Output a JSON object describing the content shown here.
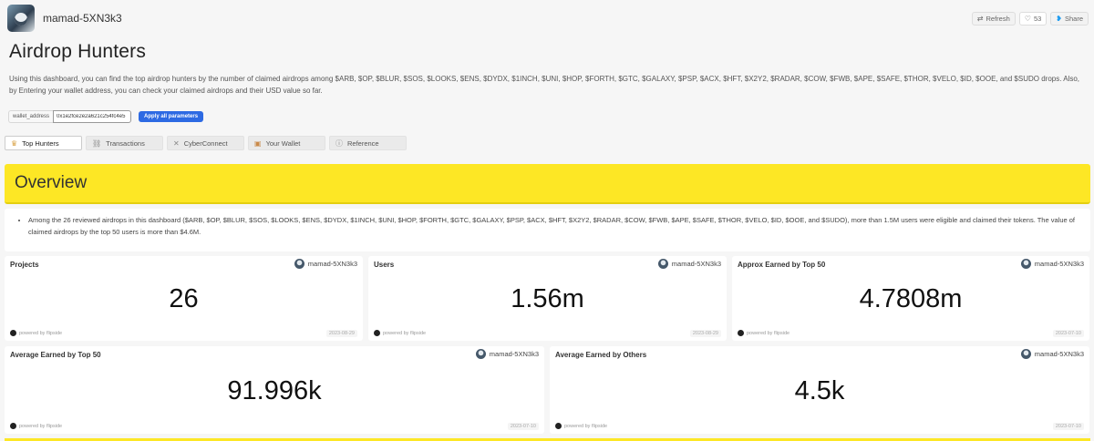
{
  "header": {
    "owner": "mamad-5XN3k3",
    "refresh_label": "Refresh",
    "likes_count": "53",
    "share_label": "Share"
  },
  "dashboard": {
    "title": "Airdrop Hunters",
    "description": "Using this dashboard, you can find the top airdrop hunters by the number of claimed airdrops among $ARB, $OP, $BLUR, $SOS, $LOOKS, $ENS, $DYDX, $1INCH, $UNI, $HOP, $FORTH, $GTC, $GALAXY, $PSP, $ACX, $HFT, $X2Y2, $RADAR, $COW, $FWB, $APE, $SAFE, $THOR, $VELO, $ID, $OOE, and $SUDO drops. Also, by Entering your wallet address, you can check your claimed airdrops and their USD value so far."
  },
  "params": {
    "label": "wallet_address",
    "value": "0x1e2fce2e2a621c254fc4e5",
    "apply_label": "Apply all parameters"
  },
  "tabs": [
    {
      "label": "Top Hunters",
      "icon": "crown-icon",
      "active": true
    },
    {
      "label": "Transactions",
      "icon": "link-icon",
      "active": false
    },
    {
      "label": "CyberConnect",
      "icon": "cross-icon",
      "active": false
    },
    {
      "label": "Your Wallet",
      "icon": "wallet-icon",
      "active": false
    },
    {
      "label": "Reference",
      "icon": "info-icon",
      "active": false
    }
  ],
  "overview": {
    "heading": "Overview",
    "bullet": "Among the 26 reviewed airdrops in this dashboard ($ARB, $OP, $BLUR, $SOS, $LOOKS, $ENS, $DYDX, $1INCH, $UNI, $HOP, $FORTH, $GTC, $GALAXY, $PSP, $ACX, $HFT, $X2Y2, $RADAR, $COW, $FWB, $APE, $SAFE, $THOR, $VELO, $ID, $OOE, and $SUDO), more than 1.5M users were eligible and claimed their tokens. The value of claimed airdrops by the top 50 users is more than $4.6M."
  },
  "cards": [
    {
      "title": "Projects",
      "value": "26",
      "author": "mamad-5XN3k3",
      "powered": "powered by flipside",
      "date": "2023-08-29"
    },
    {
      "title": "Users",
      "value": "1.56m",
      "author": "mamad-5XN3k3",
      "powered": "powered by flipside",
      "date": "2023-08-29"
    },
    {
      "title": "Approx Earned by Top 50",
      "value": "4.7808m",
      "author": "mamad-5XN3k3",
      "powered": "powered by flipside",
      "date": "2023-07-10"
    },
    {
      "title": "Average Earned by Top 50",
      "value": "91.996k",
      "author": "mamad-5XN3k3",
      "powered": "powered by flipside",
      "date": "2023-07-10"
    },
    {
      "title": "Average Earned by Others",
      "value": "4.5k",
      "author": "mamad-5XN3k3",
      "powered": "powered by flipside",
      "date": "2023-07-10"
    }
  ],
  "colors": {
    "overview_bg": "#fde725",
    "apply_button": "#2d6ae3"
  }
}
